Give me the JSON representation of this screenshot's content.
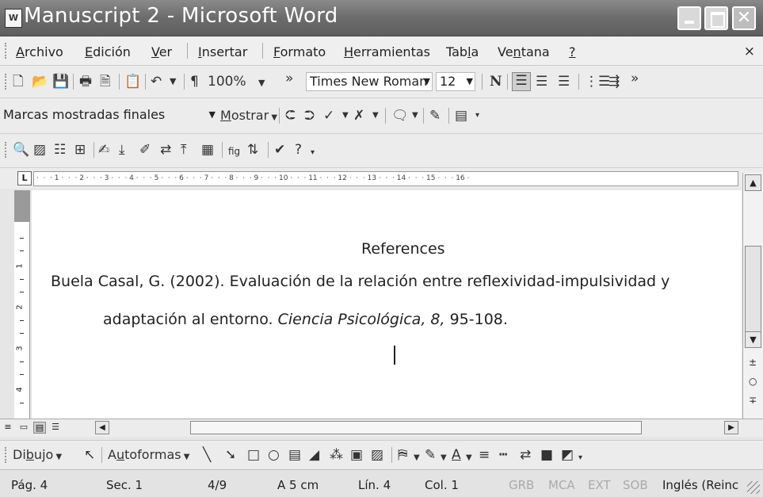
{
  "window": {
    "title": "Manuscript 2 - Microsoft Word",
    "app_icon": "word-doc-icon",
    "controls": {
      "minimize": "minimize-icon",
      "maximize": "maximize-icon",
      "close": "close-icon",
      "close_glyph": "✕"
    }
  },
  "menu": {
    "items": [
      {
        "pre": "",
        "u": "A",
        "post": "rchivo"
      },
      {
        "pre": "",
        "u": "E",
        "post": "dición"
      },
      {
        "pre": "",
        "u": "V",
        "post": "er"
      },
      {
        "pre": "",
        "u": "I",
        "post": "nsertar"
      },
      {
        "pre": "",
        "u": "F",
        "post": "ormato"
      },
      {
        "pre": "",
        "u": "H",
        "post": "erramientas"
      },
      {
        "pre": "Tab",
        "u": "l",
        "post": "a"
      },
      {
        "pre": "Ve",
        "u": "n",
        "post": "tana"
      },
      {
        "pre": "",
        "u": "?",
        "post": ""
      }
    ],
    "close_doc": "×"
  },
  "standard_toolbar": {
    "zoom": "100%",
    "font": "Times New Roman",
    "size": "12",
    "bold_glyph": "N",
    "more": "»",
    "paragraph_mark": "¶"
  },
  "review_toolbar": {
    "display_mode": "Marcas mostradas finales",
    "show_pre": "",
    "show_u": "M",
    "show_post": "ostrar"
  },
  "ruler": {
    "text": " ·  ·  · 1 ·  ·  · 2 ·  ·  · 3 ·  ·  · 4 ·  ·  · 5 ·  ·  · 6 ·  ·  · 7 ·  ·  · 8 ·  ·  · 9 ·  ·  · 10 ·  ·  · 11 ·  ·  · 12 ·  ·  · 13 ·  ·  · 14 ·  ·  · 15 ·  ·  · 16 · ",
    "vertical_numbers": [
      "1",
      "2",
      "3",
      "4"
    ]
  },
  "document": {
    "heading": "References",
    "line1": "Buela Casal, G. (2002). Evaluación de la relación entre reflexividad-impulsividad y",
    "line2_start": "adaptación al entorno. ",
    "line2_italic": "Ciencia Psicológica, 8,",
    "line2_end": " 95-108."
  },
  "draw_toolbar": {
    "draw_pre": "Di",
    "draw_u": "b",
    "draw_post": "ujo",
    "autoshapes_pre": "A",
    "autoshapes_u": "u",
    "autoshapes_post": "toformas"
  },
  "status": {
    "page": "Pág. 4",
    "section": "Sec. 1",
    "pages": "4/9",
    "at": "A 5 cm",
    "line": "Lín. 4",
    "col": "Col. 1",
    "grb": "GRB",
    "mca": "MCA",
    "ext": "EXT",
    "sob": "SOB",
    "language": "Inglés (Reinc"
  }
}
